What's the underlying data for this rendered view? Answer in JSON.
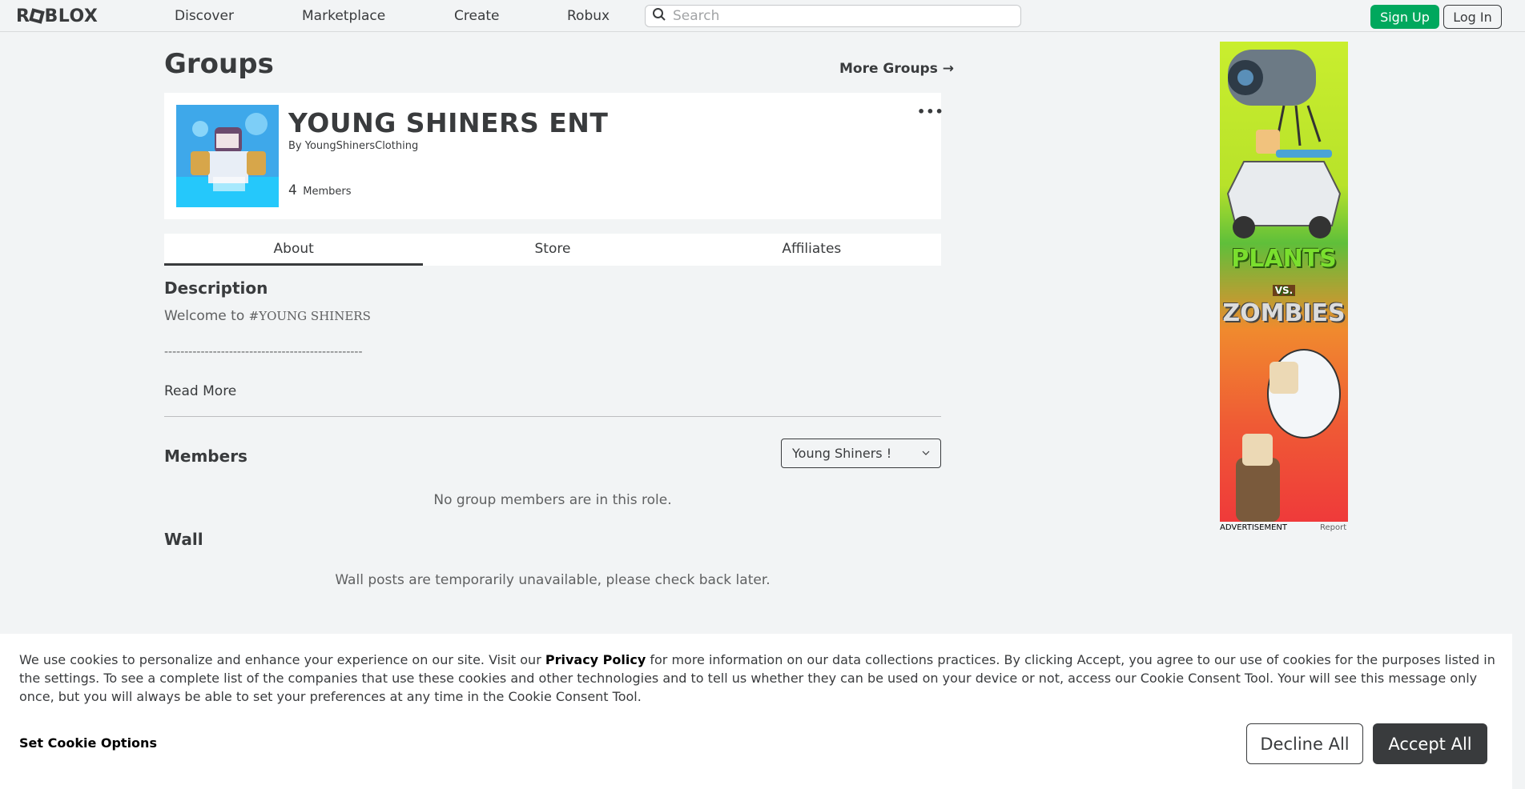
{
  "nav": {
    "logo": "ROBLOX",
    "links": [
      "Discover",
      "Marketplace",
      "Create",
      "Robux"
    ],
    "search_placeholder": "Search",
    "signup": "Sign Up",
    "login": "Log In"
  },
  "page": {
    "title": "Groups",
    "more_groups": "More Groups →"
  },
  "group": {
    "name": "YOUNG SHINERS ENT",
    "by_prefix": "By",
    "owner": "YoungShinersClothing",
    "member_count": "4",
    "members_label": "Members",
    "more_menu": "•••"
  },
  "tabs": [
    {
      "label": "About",
      "active": true
    },
    {
      "label": "Store",
      "active": false
    },
    {
      "label": "Affiliates",
      "active": false
    }
  ],
  "about": {
    "description_heading": "Description",
    "description_prefix": "Welcome to ",
    "description_name": "#YOUNG SHINERS",
    "dashes": "-------------------------------------------------",
    "read_more": "Read More",
    "members_heading": "Members",
    "role_selected": "Young Shiners !",
    "members_empty": "No group members are in this role.",
    "wall_heading": "Wall",
    "wall_unavailable": "Wall posts are temporarily unavailable, please check back later."
  },
  "ad": {
    "title_line1": "PLANTS",
    "vs": "VS.",
    "title_line2": "ZOMBIES",
    "label": "ADVERTISEMENT",
    "report": "Report"
  },
  "cookie": {
    "text_before": "We use cookies to personalize and enhance your experience on our site. Visit our ",
    "privacy_link": "Privacy Policy",
    "text_after": " for more information on our data collections practices. By clicking Accept, you agree to our use of cookies for the purposes listed in the settings. To see a complete list of the companies that use these cookies and other technologies and to tell us whether they can be used on your device or not, access our Cookie Consent Tool. Your will see this message only once, but you will always be able to set your preferences at any time in the Cookie Consent Tool.",
    "set_options": "Set Cookie Options",
    "decline": "Decline All",
    "accept": "Accept All"
  },
  "colors": {
    "signup_green": "#00a85d",
    "accept_dark": "#393b3d",
    "page_bg": "#f2f4f5"
  }
}
